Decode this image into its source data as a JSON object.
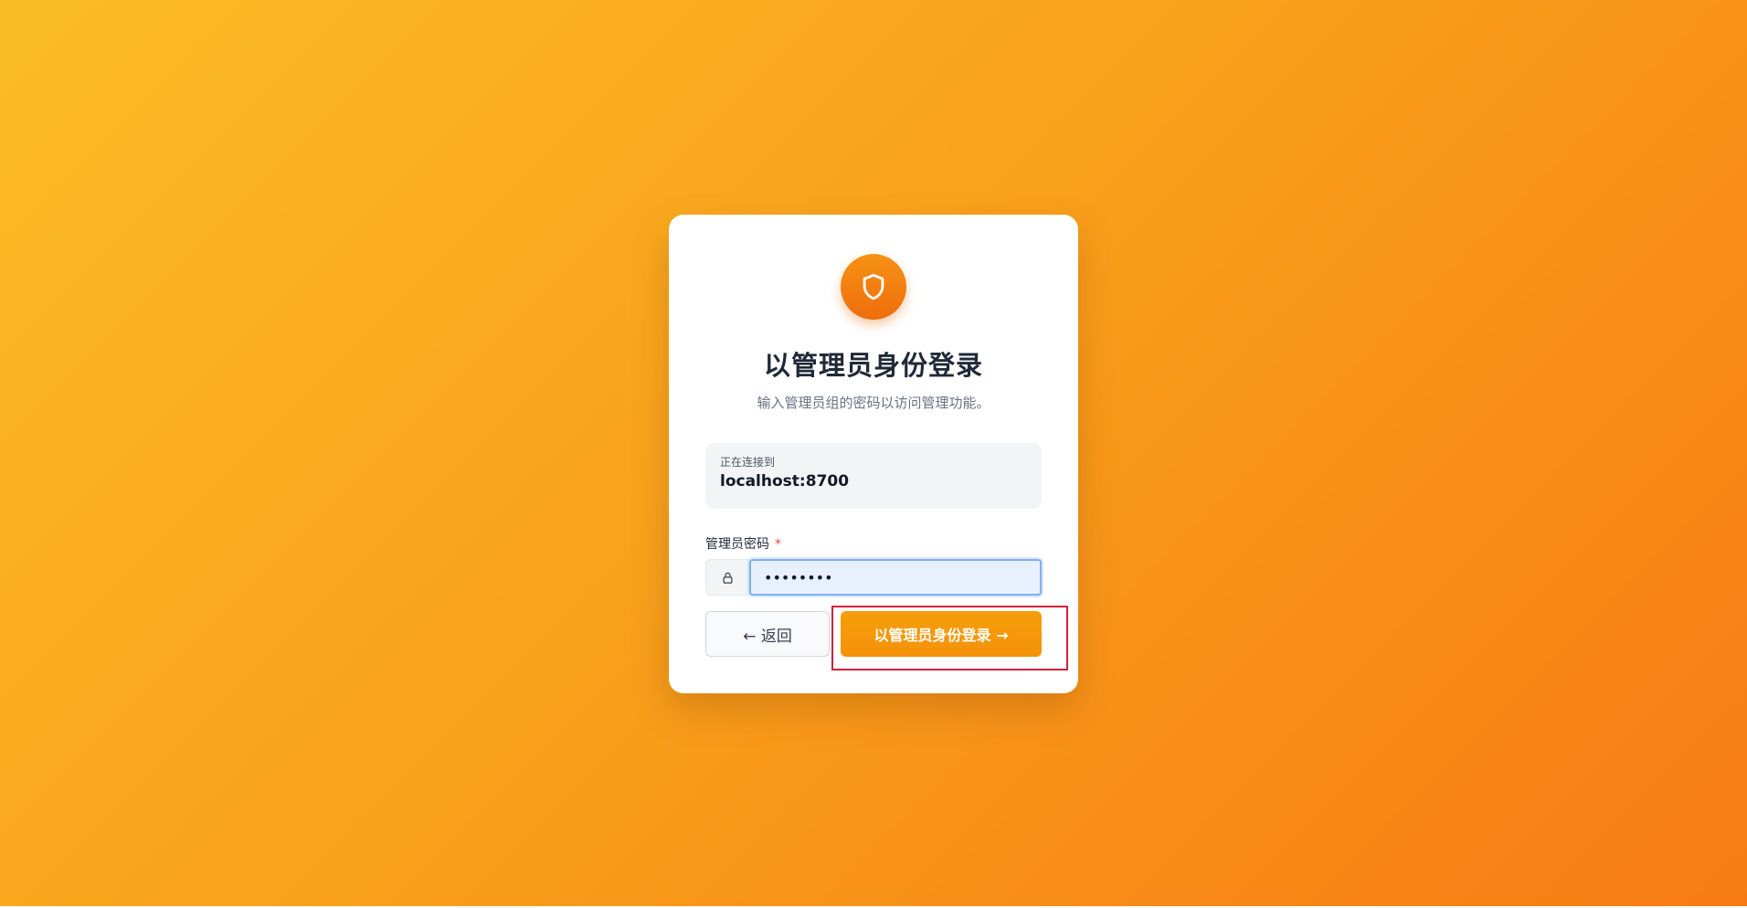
{
  "login": {
    "title": "以管理员身份登录",
    "subtitle": "输入管理员组的密码以访问管理功能。",
    "connection": {
      "label": "正在连接到",
      "host": "localhost:8700"
    },
    "password": {
      "label": "管理员密码",
      "required_mark": "*",
      "value": "••••••••"
    },
    "back_button": "← 返回",
    "login_button": "以管理员身份登录 →"
  },
  "icons": {
    "logo": "shield-icon",
    "input_addon": "lock-icon"
  },
  "colors": {
    "accent": "#f59e0b",
    "logo": "#ee6d0c",
    "highlight": "#d61f3a"
  }
}
